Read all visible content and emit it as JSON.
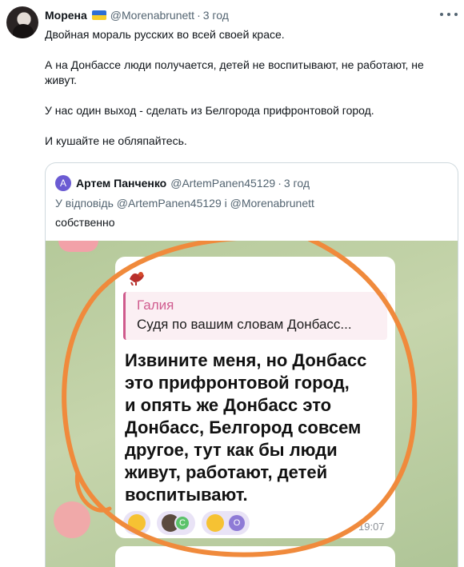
{
  "tweet": {
    "author_name": "Морена",
    "flag_icon": "ukraine-flag-icon",
    "handle": "@Morenabrunett",
    "separator": "·",
    "time": "3 год",
    "more_icon": "more-icon",
    "paragraphs": [
      "Двойная мораль русских во всей своей красе.",
      "А на Донбассе люди получается, детей не воспитывают, не работают, не живут.",
      "У нас один выход - сделать из Белгорода прифронтовой город.",
      "И кушайте не обляпайтесь."
    ]
  },
  "quote": {
    "avatar_letter": "А",
    "author_name": "Артем Панченко",
    "handle": "@ArtemPanen45129",
    "separator": "·",
    "time": "3 год",
    "reply_to": "У відповідь @ArtemPanen45129 і @Morenabrunett",
    "text": "собственно"
  },
  "screenshot": {
    "reply_name": "Галия",
    "reply_text": "Судя по вашим словам Донбасс...",
    "message_lines": [
      "Извините меня, но Донбасс",
      "это прифронтовой город,",
      "и опять же Донбасс это",
      "Донбасс, Белгород совсем",
      "другое, тут как бы люди",
      "живут, работают, детей",
      "воспитывают."
    ],
    "reactions": [
      {
        "icon": "smiling-face-emoji-icon",
        "letter": ""
      },
      {
        "icon": "user-avatar-icon",
        "letter": "С"
      },
      {
        "icon": "rofl-emoji-icon",
        "letter": "О"
      }
    ],
    "time": "19:07",
    "annotation_color": "#f08a3c"
  },
  "colors": {
    "text": "#0f1419",
    "muted": "#536471",
    "border": "#cfd9de",
    "chat_background": "#b8cc9c",
    "reply_accent": "#cf5a8c"
  }
}
